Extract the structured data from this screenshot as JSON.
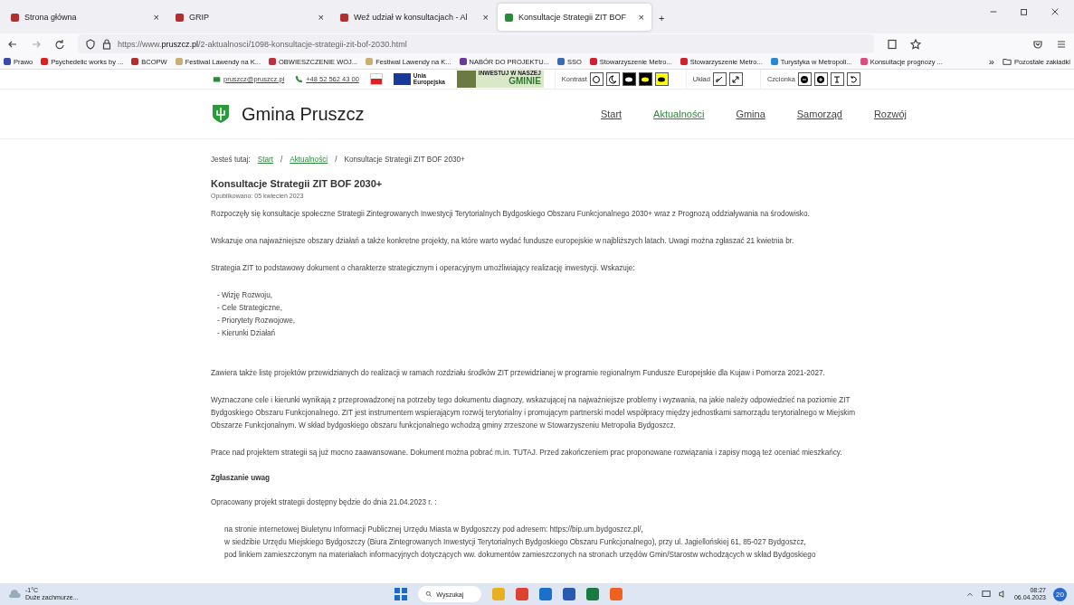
{
  "browser": {
    "tabs": [
      {
        "title": "Strona główna",
        "close": "×",
        "selected": false
      },
      {
        "title": "GRIP",
        "close": "×",
        "selected": false
      },
      {
        "title": "Weź udział w konsultacjach - Al",
        "close": "×",
        "selected": false
      },
      {
        "title": "Konsultacje Strategii ZIT BOF",
        "close": "×",
        "selected": true
      }
    ],
    "new_tab": "+",
    "url": {
      "prefix": "https://www.",
      "domain": "pruszcz.pl",
      "path": "/2-aktualnosci/1098-konsultacje-strategii-zit-bof-2030.html"
    },
    "bookmarks": [
      {
        "label": "Prawo",
        "color": "#3b4aa8"
      },
      {
        "label": "Psychedelic works by ...",
        "color": "#e02020"
      },
      {
        "label": "BCOPW",
        "color": "#b03030"
      },
      {
        "label": "Festiwal Lawendy na K...",
        "color": "#c8b070"
      },
      {
        "label": "OBWIESZCZENIE WOJ...",
        "color": "#c03040"
      },
      {
        "label": "Festiwal Lawendy na K...",
        "color": "#c8b070"
      },
      {
        "label": "NABÓR DO PROJEKTU...",
        "color": "#6a3a9a"
      },
      {
        "label": "SSO",
        "color": "#3a6ab0"
      },
      {
        "label": "Stowarzyszenie Metro...",
        "color": "#d02030"
      },
      {
        "label": "Stowarzyszenie Metro...",
        "color": "#d02030"
      },
      {
        "label": "Turystyka w Metropoli...",
        "color": "#2a8ad0"
      },
      {
        "label": "Konsultacje prognozy ...",
        "color": "#e04a80"
      }
    ],
    "more_bookmarks": "»",
    "other_bookmarks": "Pozostałe zakładki"
  },
  "topbar": {
    "email": "pruszcz@pruszcz.pl",
    "phone": "+48 52 562 43 00",
    "eu_label": "Unia Europejska",
    "banner_top": "INWESTUJ W NASZEJ",
    "banner_main": "GMINIE",
    "contrast_label": "Kontrast",
    "contrast_options": [
      {
        "kind": "normal",
        "selected": false
      },
      {
        "kind": "night",
        "selected": false
      },
      {
        "kind": "bw",
        "selected": false
      },
      {
        "kind": "by",
        "selected": false
      },
      {
        "kind": "yb",
        "selected": false
      }
    ],
    "layout_label": "Układ",
    "layout_options": [
      {
        "kind": "shrink"
      },
      {
        "kind": "expand"
      }
    ],
    "font_label": "Czcionka",
    "font_options": [
      {
        "kind": "minus"
      },
      {
        "kind": "plus"
      },
      {
        "kind": "text"
      },
      {
        "kind": "reset"
      }
    ]
  },
  "site": {
    "name": "Gmina Pruszcz",
    "nav": [
      {
        "label": "Start",
        "selected": false
      },
      {
        "label": "Aktualności",
        "selected": true
      },
      {
        "label": "Gmina",
        "selected": false
      },
      {
        "label": "Samorząd",
        "selected": false
      },
      {
        "label": "Rozwój",
        "selected": false
      }
    ]
  },
  "breadcrumb": {
    "label": "Jesteś tutaj:",
    "links": [
      "Start",
      "Aktualności"
    ],
    "separator": "/",
    "current": "Konsultacje Strategii ZIT BOF 2030+"
  },
  "article": {
    "title": "Konsultacje Strategii ZIT BOF 2030+",
    "published": "Opublikowano: 05 kwiecień 2023",
    "blocks": [
      {
        "kind": "para",
        "text": "Rozpoczęły się konsultacje społeczne Strategii Zintegrowanych Inwestycji Terytorialnych Bydgoskiego Obszaru Funkcjonalnego 2030+ wraz z Prognozą oddziaływania na środowisko."
      },
      {
        "kind": "para",
        "text": "Wskazuje ona najważniejsze obszary działań a także konkretne projekty, na które warto wydać fundusze europejskie w najbliższych latach. Uwagi można zgłaszać 21 kwietnia br."
      },
      {
        "kind": "para",
        "text": "Strategia ZIT to podstawowy dokument o charakterze strategicznym i operacyjnym umożliwiający realizację inwestycji. Wskazuje:"
      },
      {
        "kind": "list",
        "items": [
          "- Wizję Rozwoju,",
          "- Cele Strategiczne,",
          "- Priorytety Rozwojowe,",
          "- Kierunki Działań"
        ]
      },
      {
        "kind": "para",
        "text": "Zawiera także listę projektów przewidzianych do realizacji w ramach rozdziału środków ZIT przewidzianej w programie regionalnym Fundusze Europejskie dla Kujaw i Pomorza 2021-2027."
      },
      {
        "kind": "para",
        "text": " Wyznaczone cele i kierunki wynikają z przeprowadzonej na potrzeby tego dokumentu diagnozy, wskazującej na najważniejsze problemy i wyzwania, na jakie należy odpowiedzieć na poziomie ZIT Bydgoskiego Obszaru Funkcjonalnego. ZIT jest instrumentem wspierającym rozwój terytorialny i promującym partnerski model współpracy między jednostkami samorządu terytorialnego w Miejskim Obszarze Funkcjonalnym. W skład bydgoskiego obszaru funkcjonalnego wchodzą gminy zrzeszone w Stowarzyszeniu Metropolia Bydgoszcz."
      },
      {
        "kind": "para",
        "text": "Prace nad projektem strategii są już mocno zaawansowane. Dokument można pobrać m.in. TUTAJ. Przed zakończeniem prac proponowane rozwiązania i zapisy mogą też oceniać mieszkańcy."
      },
      {
        "kind": "heading",
        "text": "Zgłaszanie uwag"
      },
      {
        "kind": "para",
        "text": "Opracowany projekt strategii dostępny będzie do dnia 21.04.2023 r. :"
      },
      {
        "kind": "list",
        "items": [
          "na stronie internetowej Biuletynu Informacji Publicznej Urzędu Miasta w Bydgoszczy pod adresem: https://bip.um.bydgoszcz.pl/,",
          "w siedzibie Urzędu Miejskiego Bydgoszczy (Biura Zintegrowanych Inwestycji Terytorialnych Bydgoskiego Obszaru Funkcjonalnego),  przy ul. Jagiellońskiej 61, 85-027 Bydgoszcz,",
          "pod linkiem zamieszczonym na materiałach informacyjnych dotyczących ww. dokumentów  zamieszczonych na stronach urzędów Gmin/Starostw wchodzących w skład Bydgoskiego"
        ]
      }
    ]
  },
  "taskbar": {
    "temperature": "-1°C",
    "weather": "Duże zachmurze...",
    "search": "Wyszukaj",
    "time": "08:27",
    "date": "06.04.2023",
    "notifications": "20"
  }
}
